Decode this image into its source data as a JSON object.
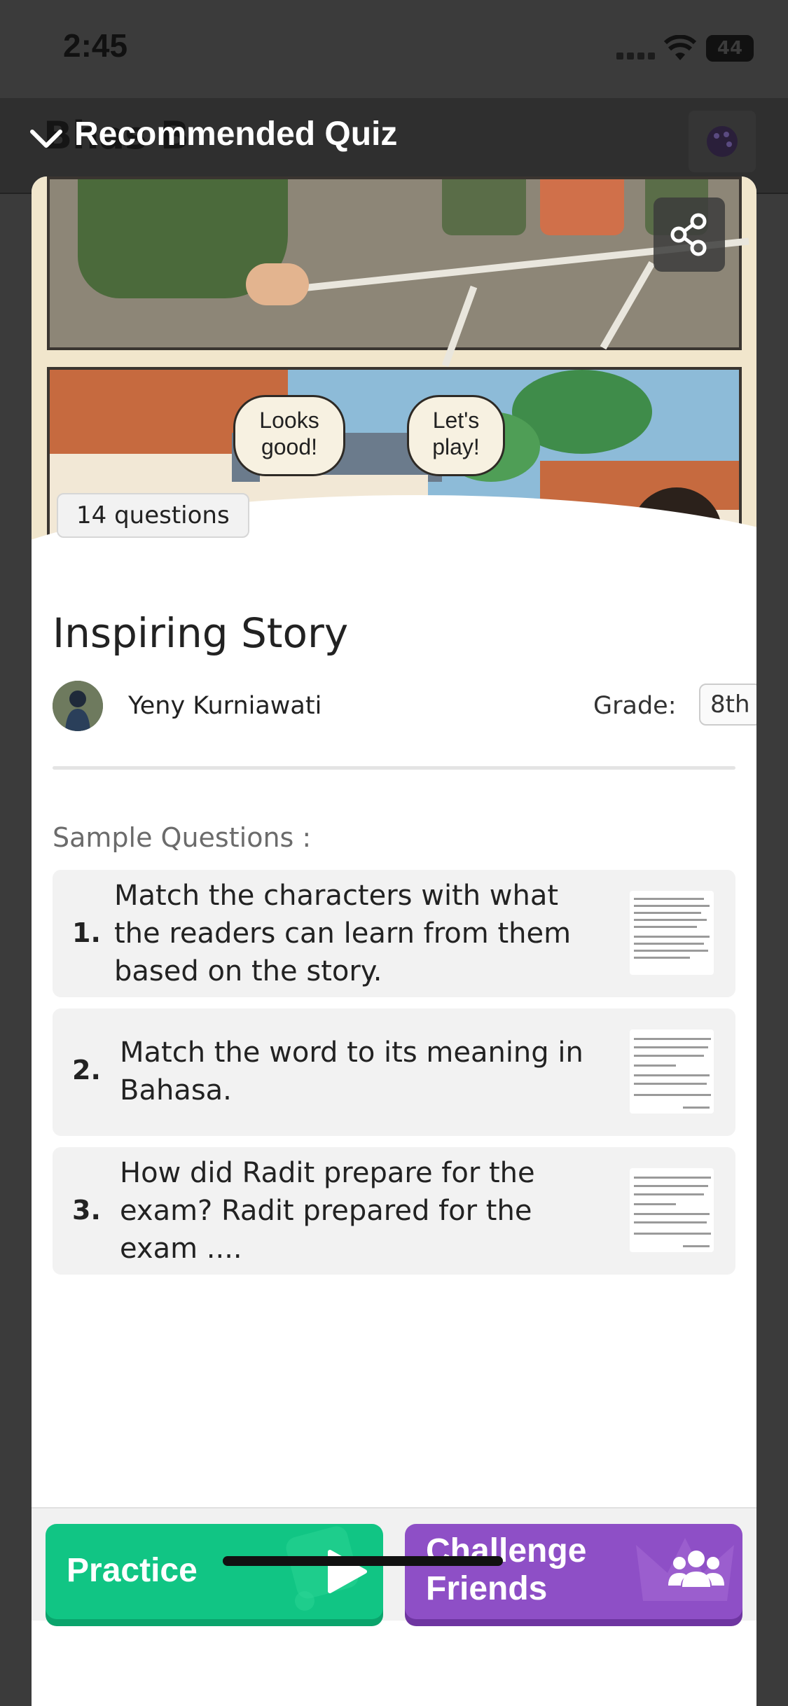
{
  "status_bar": {
    "time": "2:45",
    "battery": "44"
  },
  "background_page": {
    "title": "Bhas B"
  },
  "modal": {
    "title": "Recommended Quiz"
  },
  "hero": {
    "bubble_left": "Looks good!",
    "bubble_right": "Let's play!",
    "question_count": "14 questions"
  },
  "quiz": {
    "title": "Inspiring Story",
    "author": "Yeny Kurniawati",
    "grade_label": "Grade:",
    "grade_value": "8th"
  },
  "sample": {
    "label": "Sample Questions :",
    "questions": [
      {
        "number": "1.",
        "text": "Match the characters with what the readers can learn from them based on the story."
      },
      {
        "number": "2.",
        "text": "Match the word to its meaning in Bahasa."
      },
      {
        "number": "3.",
        "text": "How did Radit prepare for the exam? Radit prepared for the exam ...."
      }
    ]
  },
  "actions": {
    "practice": "Practice",
    "challenge": "Challenge Friends"
  },
  "icons": {
    "chevron": "chevron-down-icon",
    "share": "share-icon",
    "palette": "palette-icon",
    "play": "play-icon",
    "users": "users-icon"
  },
  "colors": {
    "practice": "#11c584",
    "challenge": "#8e4fc6"
  }
}
